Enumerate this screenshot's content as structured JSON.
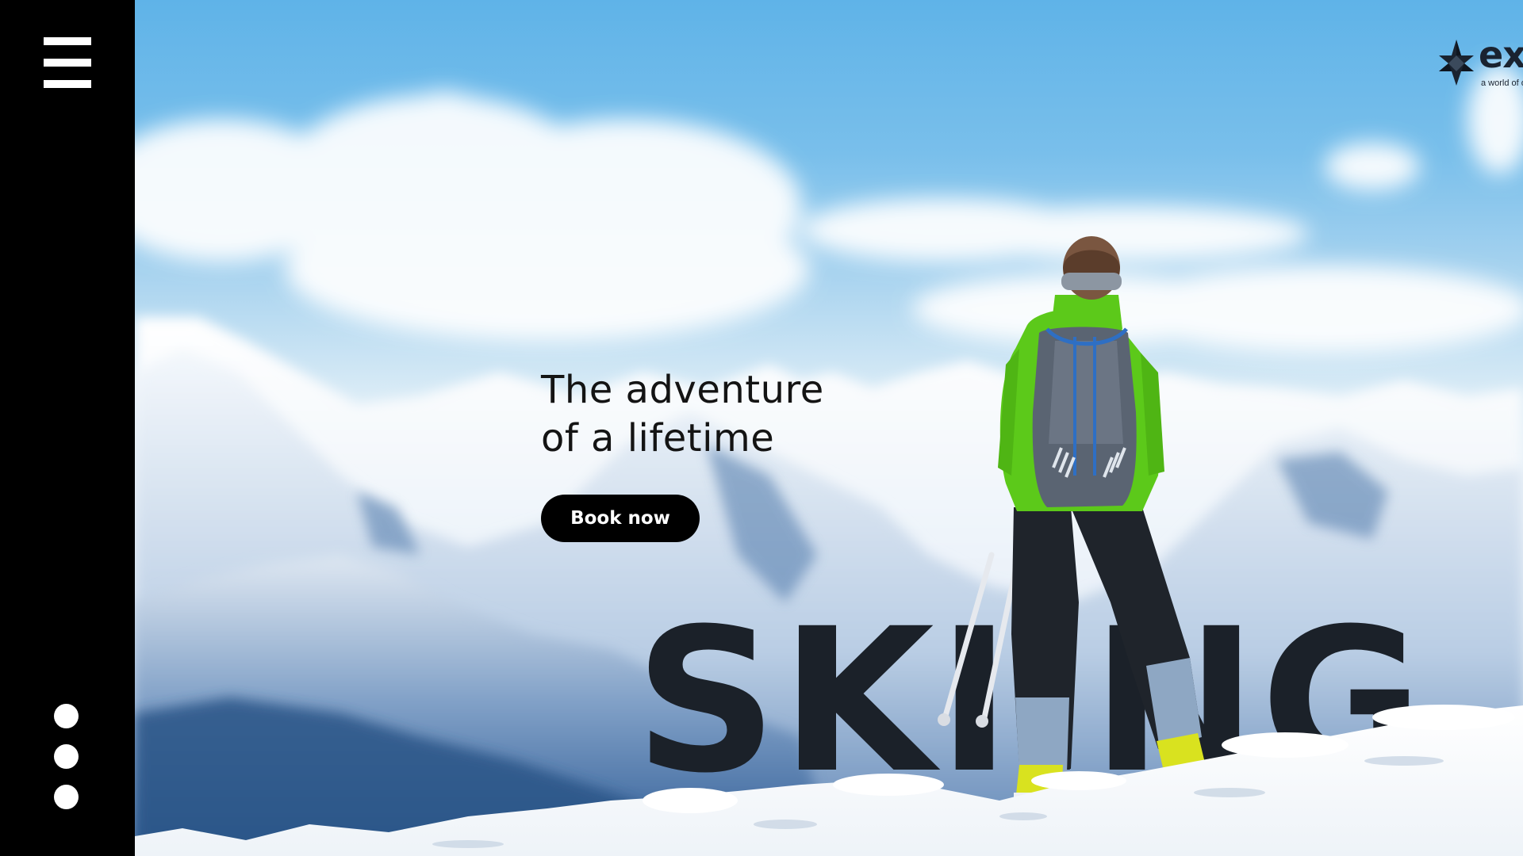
{
  "sidebar": {
    "menu_icon": "hamburger-menu-icon",
    "pager_dots": 3
  },
  "brand": {
    "name": "explore",
    "tagline": "a world of opportunity",
    "logo_icon": "star-compass-icon"
  },
  "hero": {
    "headline_line1": "The adventure",
    "headline_line2": "of a lifetime",
    "cta_label": "Book now",
    "big_word": "SKIING"
  },
  "colors": {
    "sidebar": "#000000",
    "cta_background": "#000000",
    "cta_text": "#ffffff",
    "big_word": "#1b2129",
    "jacket": "#5cc91a"
  }
}
